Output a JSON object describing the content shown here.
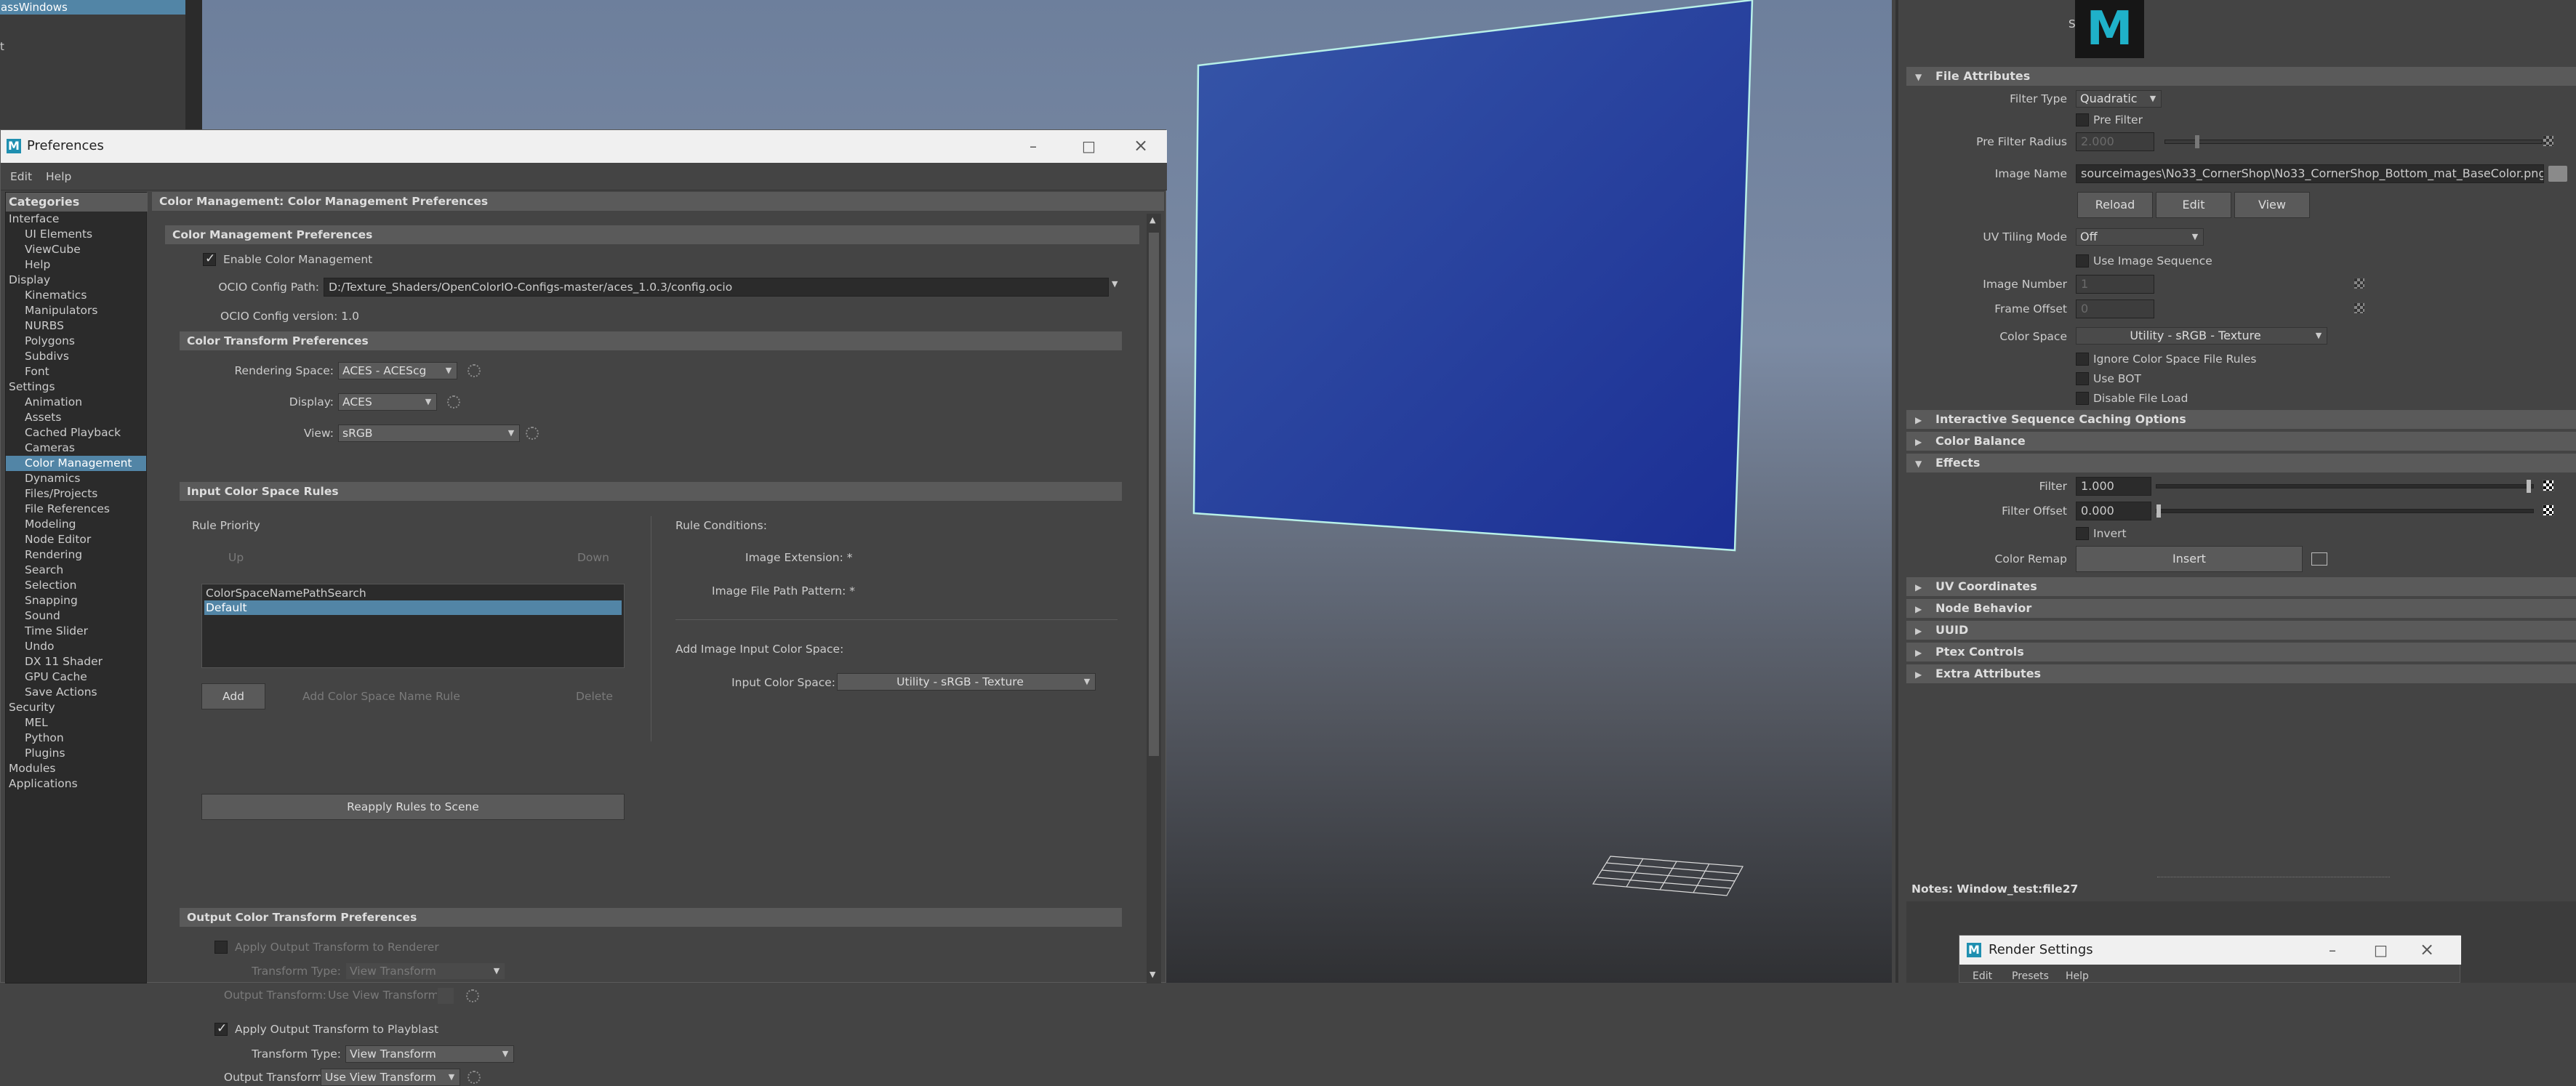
{
  "left_panel": {
    "selected_item": "assWindows",
    "items": [
      "t"
    ]
  },
  "preferences": {
    "title": "Preferences",
    "menus": [
      "Edit",
      "Help"
    ],
    "categories_header": "Categories",
    "categories": [
      {
        "label": "Interface",
        "level": 0
      },
      {
        "label": "UI Elements",
        "level": 1
      },
      {
        "label": "ViewCube",
        "level": 1
      },
      {
        "label": "Help",
        "level": 1
      },
      {
        "label": "Display",
        "level": 0
      },
      {
        "label": "Kinematics",
        "level": 1
      },
      {
        "label": "Manipulators",
        "level": 1
      },
      {
        "label": "NURBS",
        "level": 1
      },
      {
        "label": "Polygons",
        "level": 1
      },
      {
        "label": "Subdivs",
        "level": 1
      },
      {
        "label": "Font",
        "level": 1
      },
      {
        "label": "Settings",
        "level": 0
      },
      {
        "label": "Animation",
        "level": 1
      },
      {
        "label": "Assets",
        "level": 1
      },
      {
        "label": "Cached Playback",
        "level": 1
      },
      {
        "label": "Cameras",
        "level": 1
      },
      {
        "label": "Color Management",
        "level": 1,
        "selected": true
      },
      {
        "label": "Dynamics",
        "level": 1
      },
      {
        "label": "Files/Projects",
        "level": 1
      },
      {
        "label": "File References",
        "level": 1
      },
      {
        "label": "Modeling",
        "level": 1
      },
      {
        "label": "Node Editor",
        "level": 1
      },
      {
        "label": "Rendering",
        "level": 1
      },
      {
        "label": "Search",
        "level": 1
      },
      {
        "label": "Selection",
        "level": 1
      },
      {
        "label": "Snapping",
        "level": 1
      },
      {
        "label": "Sound",
        "level": 1
      },
      {
        "label": "Time Slider",
        "level": 1
      },
      {
        "label": "Undo",
        "level": 1
      },
      {
        "label": "DX 11 Shader",
        "level": 1
      },
      {
        "label": "GPU Cache",
        "level": 1
      },
      {
        "label": "Save Actions",
        "level": 1
      },
      {
        "label": "Security",
        "level": 0
      },
      {
        "label": "MEL",
        "level": 1
      },
      {
        "label": "Python",
        "level": 1
      },
      {
        "label": "Plugins",
        "level": 1
      },
      {
        "label": "Modules",
        "level": 0
      },
      {
        "label": "Applications",
        "level": 0
      }
    ],
    "content_header": "Color Management: Color Management Preferences",
    "cm_section": "Color Management Preferences",
    "enable_cm": "Enable Color Management",
    "ocio_path_label": "OCIO Config Path:",
    "ocio_path": "D:/Texture_Shaders/OpenColorIO-Configs-master/aces_1.0.3/config.ocio",
    "ocio_version": "OCIO Config version:  1.0",
    "ct_section": "Color Transform Preferences",
    "rendering_space_label": "Rendering Space:",
    "rendering_space": "ACES - ACEScg",
    "display_label": "Display:",
    "display": "ACES",
    "view_label": "View:",
    "view": "sRGB",
    "icsr_section": "Input Color Space Rules",
    "rule_priority": "Rule Priority",
    "up": "Up",
    "down": "Down",
    "rules": [
      "ColorSpaceNamePathSearch",
      "Default"
    ],
    "add": "Add",
    "add_rule": "Add Color Space Name Rule",
    "delete": "Delete",
    "reapply": "Reapply Rules to Scene",
    "rule_conditions": "Rule Conditions:",
    "image_ext": "Image Extension:  *",
    "image_path": "Image File Path Pattern:  *",
    "add_input": "Add Image Input Color Space:",
    "input_cs_label": "Input Color Space:",
    "input_cs": "Utility - sRGB - Texture",
    "oct_section": "Output Color Transform Preferences",
    "apply_renderer": "Apply Output Transform to Renderer",
    "tt_label": "Transform Type:",
    "tt_dim": "View Transform",
    "ot_label": "Output Transform:",
    "ot_dim": "Use View Transform",
    "apply_playblast": "Apply Output Transform to Playblast",
    "tt_value": "View Transform",
    "ot_value": "Use View Transform"
  },
  "attr": {
    "sample_label": "Sample",
    "logo": "M",
    "file_attributes": "File Attributes",
    "filter_type_label": "Filter Type",
    "filter_type": "Quadratic",
    "pre_filter": "Pre Filter",
    "pre_filter_radius_label": "Pre Filter Radius",
    "pre_filter_radius": "2.000",
    "image_name_label": "Image Name",
    "image_name": "sourceimages\\No33_CornerShop\\No33_CornerShop_Bottom_mat_BaseColor.png",
    "reload": "Reload",
    "edit": "Edit",
    "view": "View",
    "uv_tiling_label": "UV Tiling Mode",
    "uv_tiling": "Off",
    "use_image_seq": "Use Image Sequence",
    "image_number_label": "Image Number",
    "image_number": "1",
    "frame_offset_label": "Frame Offset",
    "frame_offset": "0",
    "color_space_label": "Color Space",
    "color_space": "Utility - sRGB - Texture",
    "ignore_cs": "Ignore Color Space File Rules",
    "use_bot": "Use BOT",
    "disable_file_load": "Disable File Load",
    "interactive": "Interactive Sequence Caching Options",
    "color_balance": "Color Balance",
    "effects": "Effects",
    "filter_label": "Filter",
    "filter": "1.000",
    "filter_level": 0.99,
    "filter_offset_label": "Filter Offset",
    "filter_offset": "0.000",
    "filter_offset_level": 0.0,
    "invert": "Invert",
    "color_remap_label": "Color Remap",
    "insert": "Insert",
    "sections": [
      "UV Coordinates",
      "Node Behavior",
      "UUID",
      "Ptex Controls",
      "Extra Attributes"
    ],
    "notes": "Notes:  Window_test:file27"
  },
  "render_settings": {
    "title": "Render Settings",
    "menus": [
      "Edit",
      "Presets",
      "Help"
    ]
  },
  "colors": {
    "accent": "#5285a6",
    "plane": "#2a3f9c",
    "plane_edge": "#b8f0e8"
  }
}
